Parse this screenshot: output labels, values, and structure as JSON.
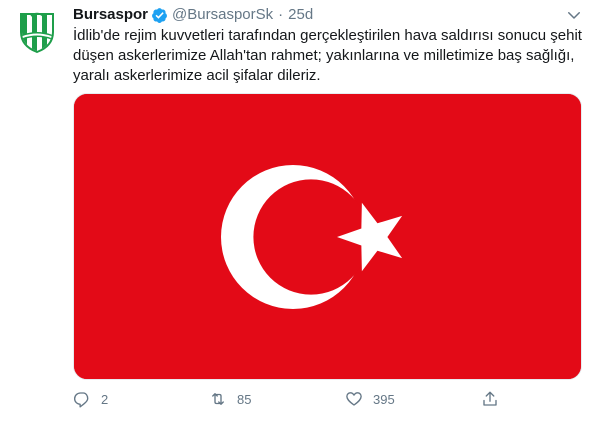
{
  "tweet": {
    "display_name": "Bursaspor",
    "handle": "@BursasporSk",
    "separator": "·",
    "time": "25d",
    "text_lines": [
      "İdlib'de rejim kuvvetleri tarafından gerçekleştirilen hava saldırısı sonucu şehit",
      "düşen askerlerimize Allah'tan rahmet; yakınlarına ve milletimize baş sağlığı,",
      "yaralı askerlerimize acil şifalar dileriz."
    ]
  },
  "avatar": {
    "icon": "bursaspor-crest-icon",
    "colors": {
      "primary": "#1e9e4a",
      "secondary": "#ffffff"
    }
  },
  "media": {
    "icon": "turkish-flag-image",
    "colors": {
      "red": "#e30a17",
      "white": "#ffffff"
    }
  },
  "actions": {
    "reply": {
      "icon": "reply-icon",
      "count": "2"
    },
    "retweet": {
      "icon": "retweet-icon",
      "count": "85"
    },
    "like": {
      "icon": "heart-icon",
      "count": "395"
    },
    "share": {
      "icon": "share-icon"
    }
  },
  "colors": {
    "verified": "#1da1f2",
    "muted_text": "#657786",
    "text": "#14171a"
  }
}
